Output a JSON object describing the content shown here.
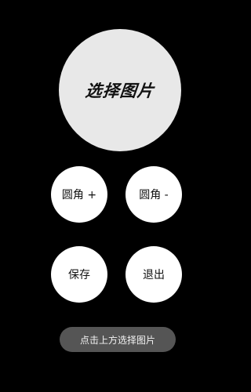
{
  "picker": {
    "label": "选择图片"
  },
  "buttons": {
    "radius_plus": "圆角 +",
    "radius_minus": "圆角 -",
    "save": "保存",
    "exit": "退出"
  },
  "toast": {
    "text": "点击上方选择图片"
  },
  "colors": {
    "background": "#000000",
    "picker_fill": "#e8e8e8",
    "button_fill": "#ffffff",
    "toast_fill": "#555555"
  }
}
